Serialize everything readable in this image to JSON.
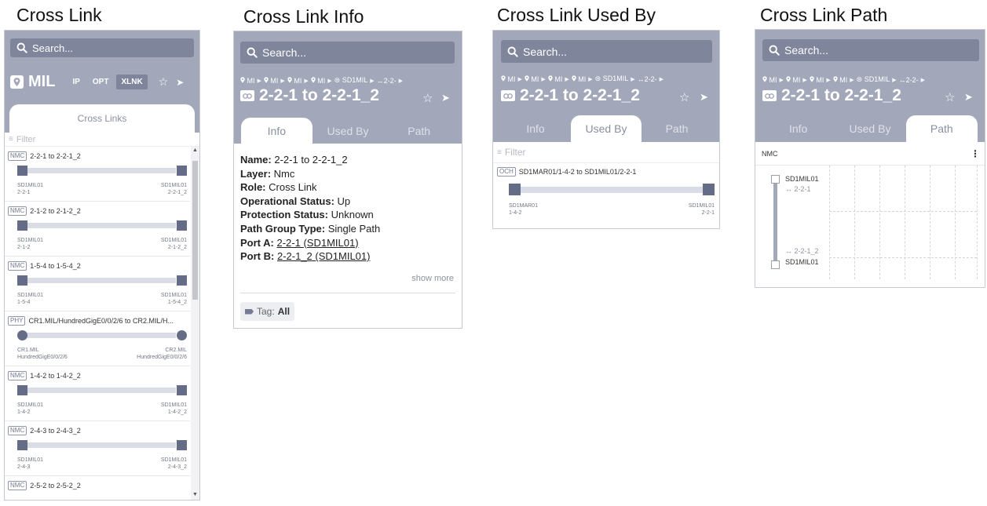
{
  "captions": {
    "cross_link": "Cross Link",
    "cross_link_info": "Cross Link Info",
    "cross_link_used_by": "Cross Link Used By",
    "cross_link_path": "Cross Link Path"
  },
  "search": {
    "placeholder": "Search..."
  },
  "colors": {
    "header": "#a2a7b9",
    "search_bg": "#7f859b",
    "endpoint": "#646c87",
    "track": "#dadde5"
  },
  "panel1": {
    "site": "MIL",
    "layers": [
      "IP",
      "OPT",
      "XLNK"
    ],
    "active_layer": "XLNK",
    "tab": "Cross Links",
    "filter": "Filter",
    "items": [
      {
        "badge": "NMC",
        "name": "2-2-1 to 2-2-1_2",
        "left_node": "SD1MIL01",
        "left_port": "2-2-1",
        "right_node": "SD1MIL01",
        "right_port": "2-2-1_2",
        "round": false
      },
      {
        "badge": "NMC",
        "name": "2-1-2 to 2-1-2_2",
        "left_node": "SD1MIL01",
        "left_port": "2-1-2",
        "right_node": "SD1MIL01",
        "right_port": "2-1-2_2",
        "round": false
      },
      {
        "badge": "NMC",
        "name": "1-5-4 to 1-5-4_2",
        "left_node": "SD1MIL01",
        "left_port": "1-5-4",
        "right_node": "SD1MIL01",
        "right_port": "1-5-4_2",
        "round": false
      },
      {
        "badge": "PHY",
        "name": "CR1.MIL/HundredGigE0/0/2/6 to CR2.MIL/H...",
        "left_node": "CR1.MIL",
        "left_port": "HundredGigE0/0/2/6",
        "right_node": "CR2.MIL",
        "right_port": "HundredGigE0/0/2/6",
        "round": true
      },
      {
        "badge": "NMC",
        "name": "1-4-2 to 1-4-2_2",
        "left_node": "SD1MIL01",
        "left_port": "1-4-2",
        "right_node": "SD1MIL01",
        "right_port": "1-4-2_2",
        "round": false
      },
      {
        "badge": "NMC",
        "name": "2-4-3 to 2-4-3_2",
        "left_node": "SD1MIL01",
        "left_port": "2-4-3",
        "right_node": "SD1MIL01",
        "right_port": "2-4-3_2",
        "round": false
      },
      {
        "badge": "NMC",
        "name": "2-5-2 to 2-5-2_2",
        "left_node": "",
        "left_port": "",
        "right_node": "",
        "right_port": "",
        "round": false
      }
    ]
  },
  "breadcrumb": [
    "MI",
    "MI",
    "MI",
    "MI",
    "SD1MIL",
    "2-2-"
  ],
  "link_title": "2-2-1 to 2-2-1_2",
  "tabs": [
    "Info",
    "Used By",
    "Path"
  ],
  "info": {
    "fields": [
      {
        "label": "Name:",
        "value": "2-2-1 to 2-2-1_2",
        "link": false
      },
      {
        "label": "Layer:",
        "value": "Nmc",
        "link": false
      },
      {
        "label": "Role:",
        "value": "Cross Link",
        "link": false
      },
      {
        "label": "Operational Status:",
        "value": "Up",
        "link": false
      },
      {
        "label": "Protection Status:",
        "value": "Unknown",
        "link": false
      },
      {
        "label": "Path Group Type:",
        "value": "Single Path",
        "link": false
      },
      {
        "label": "Port A:",
        "value": "2-2-1 (SD1MIL01)",
        "link": true
      },
      {
        "label": "Port B:",
        "value": "2-2-1_2 (SD1MIL01)",
        "link": true
      }
    ],
    "show_more": "show more",
    "tag_label": "Tag:",
    "tag_value": "All"
  },
  "used_by": {
    "filter": "Filter",
    "item": {
      "badge": "OCH",
      "name": "SD1MAR01/1-4-2 to SD1MIL01/2-2-1",
      "left_node": "SD1MAR01",
      "left_port": "1-4-2",
      "right_node": "SD1MIL01",
      "right_port": "2-2-1"
    }
  },
  "path": {
    "header": "NMC",
    "top_node": "SD1MIL01",
    "top_port": "2-2-1",
    "bottom_port": "2-2-1_2",
    "bottom_node": "SD1MIL01"
  }
}
